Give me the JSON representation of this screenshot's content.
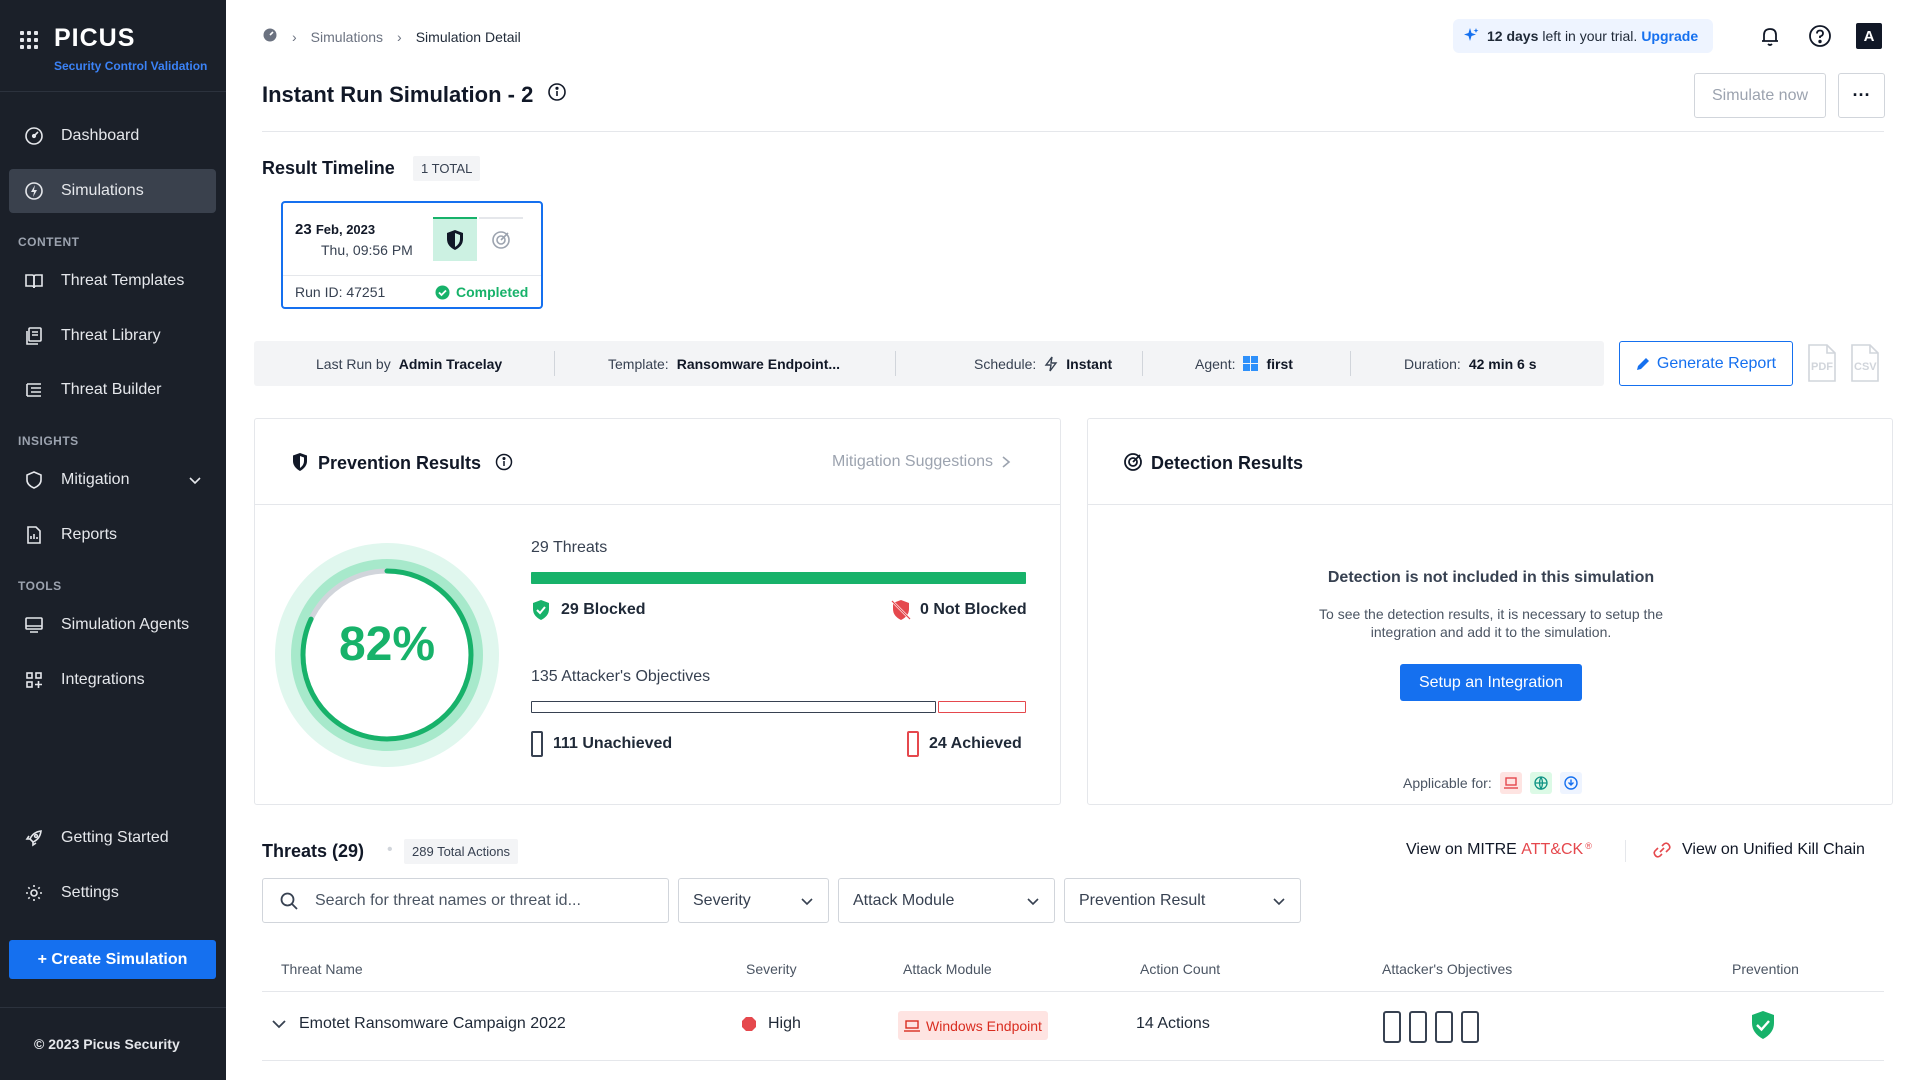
{
  "brand": {
    "logo": "PICUS",
    "tagline": "Security Control Validation"
  },
  "sidebar": {
    "items": [
      {
        "label": "Dashboard",
        "icon": "dashboard-icon"
      },
      {
        "label": "Simulations",
        "icon": "simulations-icon",
        "active": true
      },
      {
        "label": "Threat Templates",
        "icon": "book-icon"
      },
      {
        "label": "Threat Library",
        "icon": "library-icon"
      },
      {
        "label": "Threat Builder",
        "icon": "builder-icon"
      },
      {
        "label": "Mitigation",
        "icon": "shield-icon"
      },
      {
        "label": "Reports",
        "icon": "report-icon"
      },
      {
        "label": "Simulation Agents",
        "icon": "monitor-icon"
      },
      {
        "label": "Integrations",
        "icon": "integrations-icon"
      },
      {
        "label": "Getting Started",
        "icon": "rocket-icon"
      },
      {
        "label": "Settings",
        "icon": "gear-icon"
      }
    ],
    "sections": {
      "content": "CONTENT",
      "insights": "INSIGHTS",
      "tools": "TOOLS"
    },
    "create_label": "+ Create Simulation",
    "copyright": "© 2023 Picus Security"
  },
  "header": {
    "breadcrumb": {
      "item1": "Simulations",
      "current": "Simulation Detail"
    },
    "trial": {
      "days": "12 days",
      "text": "left in your trial.",
      "upgrade": "Upgrade"
    },
    "avatar": "A",
    "title": "Instant Run Simulation - 2",
    "simulate_label": "Simulate now",
    "more_label": "···"
  },
  "timeline": {
    "title": "Result Timeline",
    "total": "1 TOTAL",
    "card": {
      "day": "23",
      "month_year": "Feb, 2023",
      "time": "Thu, 09:56 PM",
      "run_id": "Run ID: 47251",
      "status": "Completed"
    }
  },
  "meta": {
    "last_run_label": "Last Run by",
    "last_run_value": "Admin Tracelay",
    "template_label": "Template:",
    "template_value": "Ransomware Endpoint...",
    "schedule_label": "Schedule:",
    "schedule_value": "Instant",
    "agent_label": "Agent:",
    "agent_value": "first",
    "duration_label": "Duration:",
    "duration_value": "42 min 6 s",
    "report_label": "Generate Report",
    "pdf": "PDF",
    "csv": "CSV"
  },
  "prevention": {
    "title": "Prevention Results",
    "mitigation_link": "Mitigation Suggestions",
    "percent_label": "82%",
    "percent_value": 82,
    "threats_label": "29 Threats",
    "blocked": 29,
    "not_blocked": 0,
    "blocked_label": "29 Blocked",
    "not_blocked_label": "0 Not Blocked",
    "objectives_label": "135 Attacker's Objectives",
    "unachieved": 111,
    "achieved": 24,
    "unachieved_label": "111 Unachieved",
    "achieved_label": "24 Achieved",
    "colors": {
      "green": "#17b26a",
      "red": "#e5484d",
      "dark": "#374151"
    }
  },
  "detection": {
    "title": "Detection Results",
    "heading": "Detection is not included in this simulation",
    "line1": "To see the detection results, it is necessary to setup the",
    "line2": "integration and add it to the simulation.",
    "button": "Setup an Integration",
    "applicable": "Applicable for:"
  },
  "threats": {
    "title": "Threats (29)",
    "actions": "289 Total Actions",
    "mitre_prefix": "View on MITRE ",
    "mitre_brand": "ATT&CK",
    "killchain": "View on Unified Kill Chain",
    "search_placeholder": "Search for threat names or threat id...",
    "filters": {
      "severity": "Severity",
      "module": "Attack Module",
      "prevention": "Prevention Result"
    },
    "columns": [
      "Threat Name",
      "Severity",
      "Attack Module",
      "Action Count",
      "Attacker's Objectives",
      "Prevention"
    ],
    "rows": [
      {
        "name": "Emotet Ransomware Campaign 2022",
        "severity": "High",
        "module": "Windows Endpoint",
        "actions": "14 Actions"
      }
    ]
  }
}
